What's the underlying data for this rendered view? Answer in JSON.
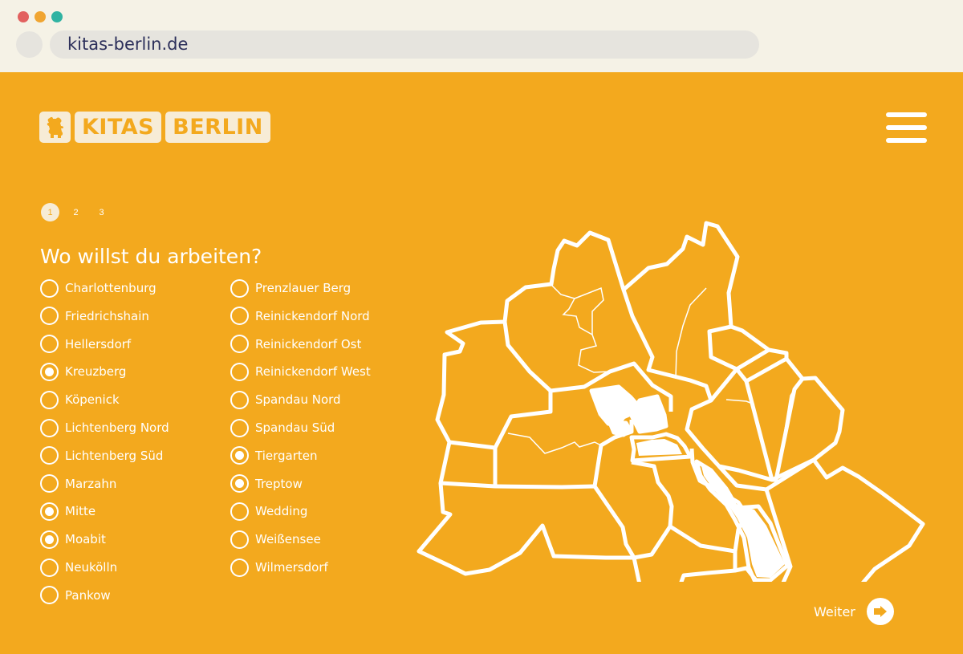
{
  "browser": {
    "url": "kitas-berlin.de"
  },
  "logo": {
    "word1": "KITAS",
    "word2": "BERLIN"
  },
  "steps": [
    "1",
    "2",
    "3"
  ],
  "active_step": "1",
  "question": "Wo willst du arbeiten?",
  "districts_left": [
    {
      "label": "Charlottenburg",
      "checked": false
    },
    {
      "label": "Friedrichshain",
      "checked": false
    },
    {
      "label": "Hellersdorf",
      "checked": false
    },
    {
      "label": "Kreuzberg",
      "checked": true
    },
    {
      "label": "Köpenick",
      "checked": false
    },
    {
      "label": "Lichtenberg Nord",
      "checked": false
    },
    {
      "label": "Lichtenberg Süd",
      "checked": false
    },
    {
      "label": "Marzahn",
      "checked": false
    },
    {
      "label": "Mitte",
      "checked": true
    },
    {
      "label": "Moabit",
      "checked": true
    },
    {
      "label": "Neukölln",
      "checked": false
    },
    {
      "label": "Pankow",
      "checked": false
    }
  ],
  "districts_right": [
    {
      "label": "Prenzlauer Berg",
      "checked": false
    },
    {
      "label": "Reinickendorf Nord",
      "checked": false
    },
    {
      "label": "Reinickendorf Ost",
      "checked": false
    },
    {
      "label": "Reinickendorf West",
      "checked": false
    },
    {
      "label": "Spandau Nord",
      "checked": false
    },
    {
      "label": "Spandau Süd",
      "checked": false
    },
    {
      "label": "Tiergarten",
      "checked": true
    },
    {
      "label": "Treptow",
      "checked": true
    },
    {
      "label": "Wedding",
      "checked": false
    },
    {
      "label": "Weißensee",
      "checked": false
    },
    {
      "label": "Wilmersdorf",
      "checked": false
    }
  ],
  "next": {
    "label": "Weiter",
    "icon": "arrow-right-icon"
  },
  "colors": {
    "background": "#f3a91e",
    "foreground": "#ffffff",
    "logo_box": "#f7ecd6"
  }
}
